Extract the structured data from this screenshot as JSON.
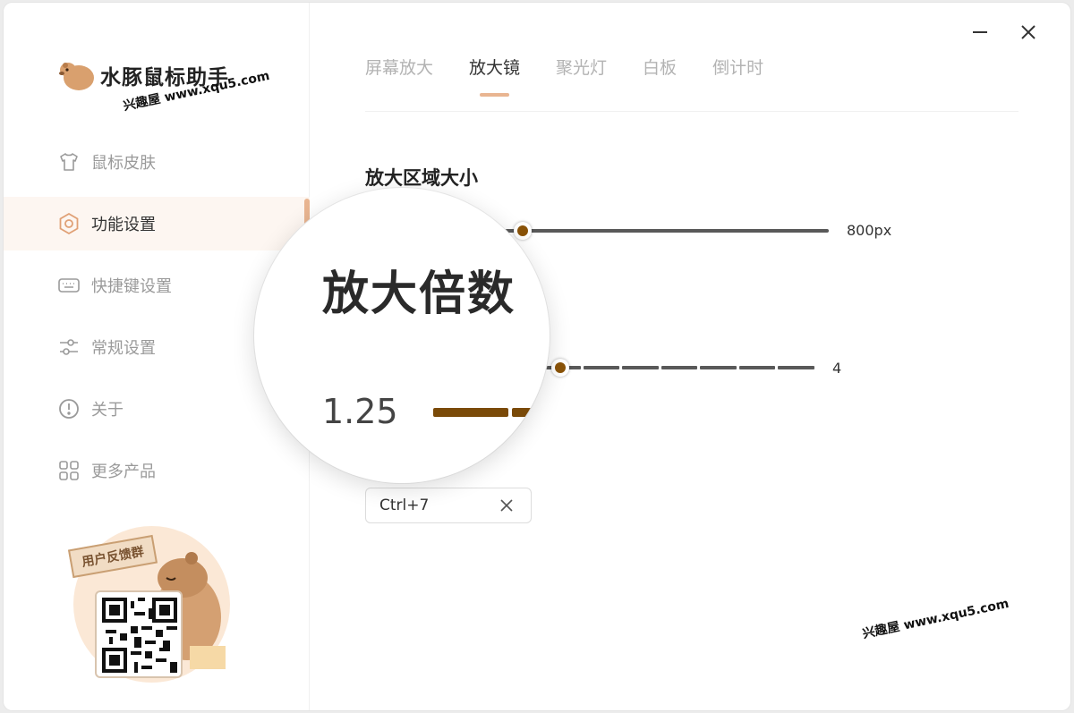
{
  "app": {
    "title": "水豚鼠标助手"
  },
  "watermark": "兴趣屋 www.xqu5.com",
  "sidebar": {
    "items": [
      {
        "label": "鼠标皮肤",
        "icon": "tshirt-icon",
        "active": false
      },
      {
        "label": "功能设置",
        "icon": "hexagon-gear-icon",
        "active": true
      },
      {
        "label": "快捷键设置",
        "icon": "keyboard-icon",
        "active": false
      },
      {
        "label": "常规设置",
        "icon": "sliders-icon",
        "active": false
      },
      {
        "label": "关于",
        "icon": "info-circle-icon",
        "active": false
      },
      {
        "label": "更多产品",
        "icon": "grid-icon",
        "active": false
      }
    ],
    "promo": {
      "sign": "用户反馈群",
      "image": "qr-code"
    }
  },
  "tabs": [
    {
      "label": "屏幕放大",
      "active": false
    },
    {
      "label": "放大镜",
      "active": true
    },
    {
      "label": "聚光灯",
      "active": false
    },
    {
      "label": "白板",
      "active": false
    },
    {
      "label": "倒计时",
      "active": false
    }
  ],
  "settings": {
    "zoom_area": {
      "title": "放大区域大小",
      "value_label": "800px",
      "position": 0.05
    },
    "zoom_factor": {
      "title": "放大倍数",
      "value_label": "1.25",
      "max_label": "4",
      "position": 0.05
    },
    "hotkey": {
      "value": "Ctrl+7"
    }
  },
  "colors": {
    "accent": "#e9b591",
    "thumb": "#8a5308",
    "track": "#595959",
    "active_bg": "#fdf6f1"
  }
}
